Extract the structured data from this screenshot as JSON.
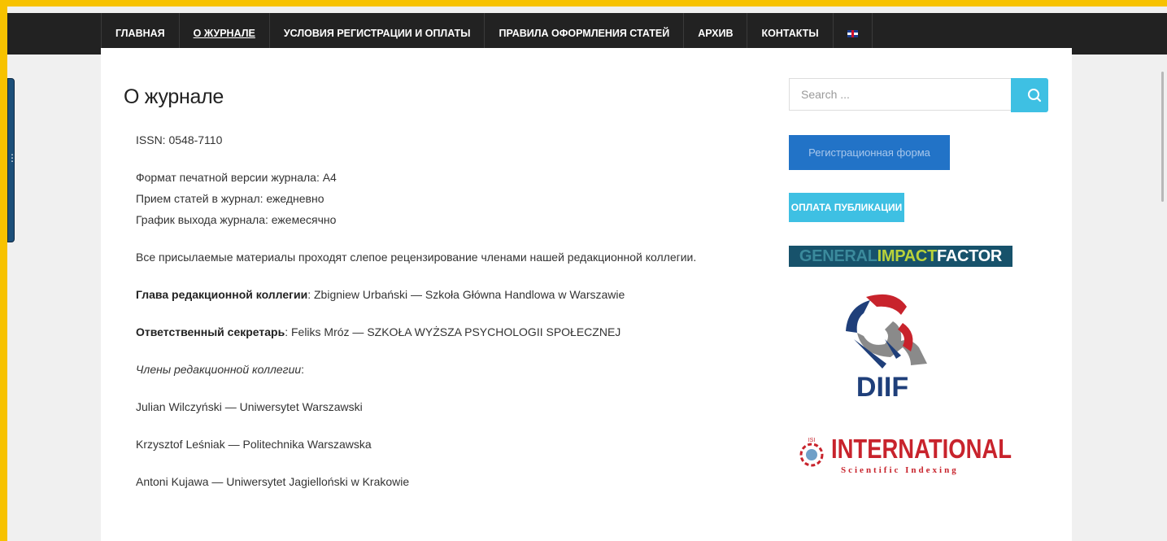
{
  "nav": {
    "items": [
      {
        "label": "ГЛАВНАЯ",
        "active": false
      },
      {
        "label": "О ЖУРНАЛЕ",
        "active": true
      },
      {
        "label": "УСЛОВИЯ РЕГИСТРАЦИИ И ОПЛАТЫ",
        "active": false
      },
      {
        "label": "ПРАВИЛА ОФОРМЛЕНИЯ СТАТЕЙ",
        "active": false
      },
      {
        "label": "АРХИВ",
        "active": false
      },
      {
        "label": "КОНТАКТЫ",
        "active": false
      }
    ],
    "language_icon": "uk-flag-icon"
  },
  "page": {
    "title": "О журнале",
    "issn": "ISSN: 0548-7110",
    "format": "Формат печатной версии журнала: А4",
    "intake": "Прием статей в журнал: ежедневно",
    "schedule": "График выхода журнала: ежемесячно",
    "review": "Все присылаемые материалы проходят слепое рецензирование членами нашей редакционной коллегии.",
    "editor_label": "Глава редакционной коллегии",
    "editor_value": ": Zbigniew Urbański  — Szkoła Główna Handlowa w Warszawie",
    "secretary_label": "Ответственный секретарь",
    "secretary_value": ": Feliks Mróz — SZKOŁA WYŻSZA PSYCHOLOGII SPOŁECZNEJ",
    "members_label": "Члены редакционной коллегии",
    "members_colon": ":",
    "members": [
      "Julian Wilczyński — Uniwersytet Warszawski",
      "Krzysztof Leśniak — Politechnika Warszawska",
      "Antoni Kujawa — Uniwersytet Jagielloński w Krakowie"
    ]
  },
  "sidebar": {
    "search_placeholder": "Search ...",
    "search_icon": "search-icon",
    "register_button": "Регистрационная форма",
    "payment_button": "ОПЛАТА ПУБЛИКАЦИИ",
    "gif_logo": {
      "part1": "GENERAL",
      "part2": "IMPACT",
      "part3": "FACTOR"
    },
    "diif_logo": "DIIF",
    "isi_logo": {
      "title": "INTERNATIONAL",
      "subtitle": "Scientific Indexing",
      "mark": "ISI"
    }
  },
  "colors": {
    "accent": "#3ec0e3",
    "nav_bg": "#222222",
    "register_bg": "#2273c7",
    "frame": "#f7c200"
  }
}
